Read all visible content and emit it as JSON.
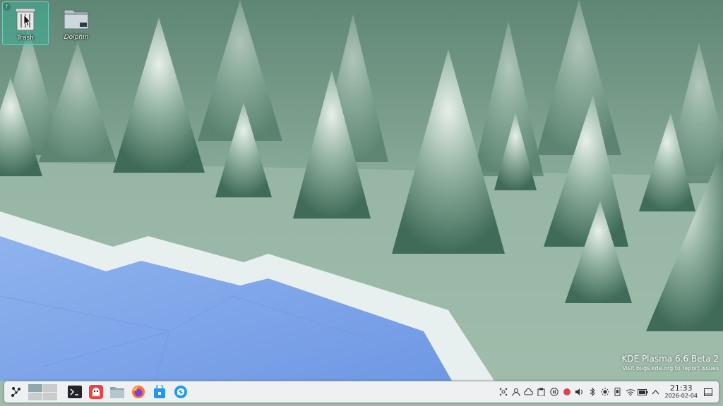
{
  "desktop": {
    "icons": [
      {
        "label": "Trash",
        "icon": "trash-icon"
      },
      {
        "label": "Dolphin",
        "icon": "folder-icon"
      }
    ]
  },
  "watermark": {
    "title": "KDE Plasma 6.6 Beta 2",
    "subtitle": "Visit bugs.kde.org to report issues"
  },
  "taskbar": {
    "launcher_icon": "kde-launcher-icon",
    "tasks": [
      {
        "name": "terminal",
        "icon": "terminal-icon"
      },
      {
        "name": "ghost-app",
        "icon": "ghost-icon"
      },
      {
        "name": "file-manager",
        "icon": "folder-icon"
      },
      {
        "name": "firefox",
        "icon": "firefox-icon"
      },
      {
        "name": "discover",
        "icon": "store-bag-icon"
      },
      {
        "name": "updater",
        "icon": "sync-icon"
      }
    ],
    "tray": [
      "network-share-icon",
      "user-icon",
      "cloud-icon",
      "clipboard-icon",
      "pause-icon",
      "record-icon",
      "volume-icon",
      "bluetooth-icon",
      "brightness-icon",
      "phone-icon",
      "wifi-icon",
      "battery-icon",
      "chevron-up-icon"
    ],
    "clock": {
      "time": "21:33",
      "date": "2026-02-04"
    }
  },
  "colors": {
    "accent": "#3daee9",
    "panel": "#eff0f1",
    "selection": "#3dae96"
  }
}
